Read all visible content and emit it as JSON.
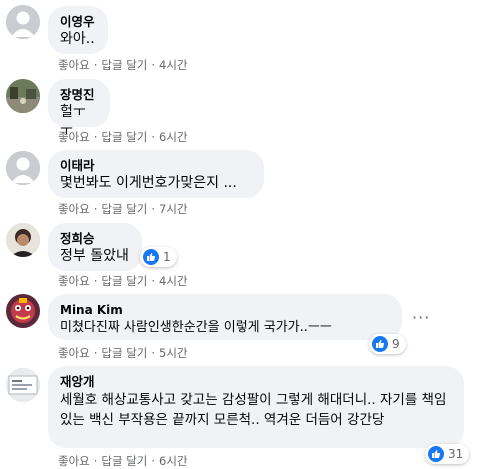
{
  "actions": {
    "like": "좋아요",
    "reply": "답글 달기",
    "sep": "·"
  },
  "comments": [
    {
      "author": "이영우",
      "text": "와아..",
      "time": "4시간"
    },
    {
      "author": "장명진",
      "text": "헐ㅜㅜ",
      "time": "6시간"
    },
    {
      "author": "이태라",
      "text": "몇번봐도 이게번호가맞은지 ...",
      "time": "7시간"
    },
    {
      "author": "정희승",
      "text": "정부 돌았내",
      "time": "4시간",
      "reactions": "1"
    },
    {
      "author": "Mina Kim",
      "text": "미쳤다진짜 사람인생한순간을 이렇게 국가가..ㅡㅡ",
      "time": "5시간",
      "reactions": "9",
      "more": "···"
    },
    {
      "author": "재앙개",
      "text": "세월호 해상교통사고 갖고는 감성팔이 그렇게 해대더니.. 자기를 책임있는 백신 부작용은 끝까지 모른척.. 역겨운 더듬어 강간당",
      "time": "6시간",
      "reactions": "31"
    }
  ],
  "colors": {
    "bubble": "#f0f2f5",
    "like": "#1877f2",
    "meta": "#65676b"
  }
}
